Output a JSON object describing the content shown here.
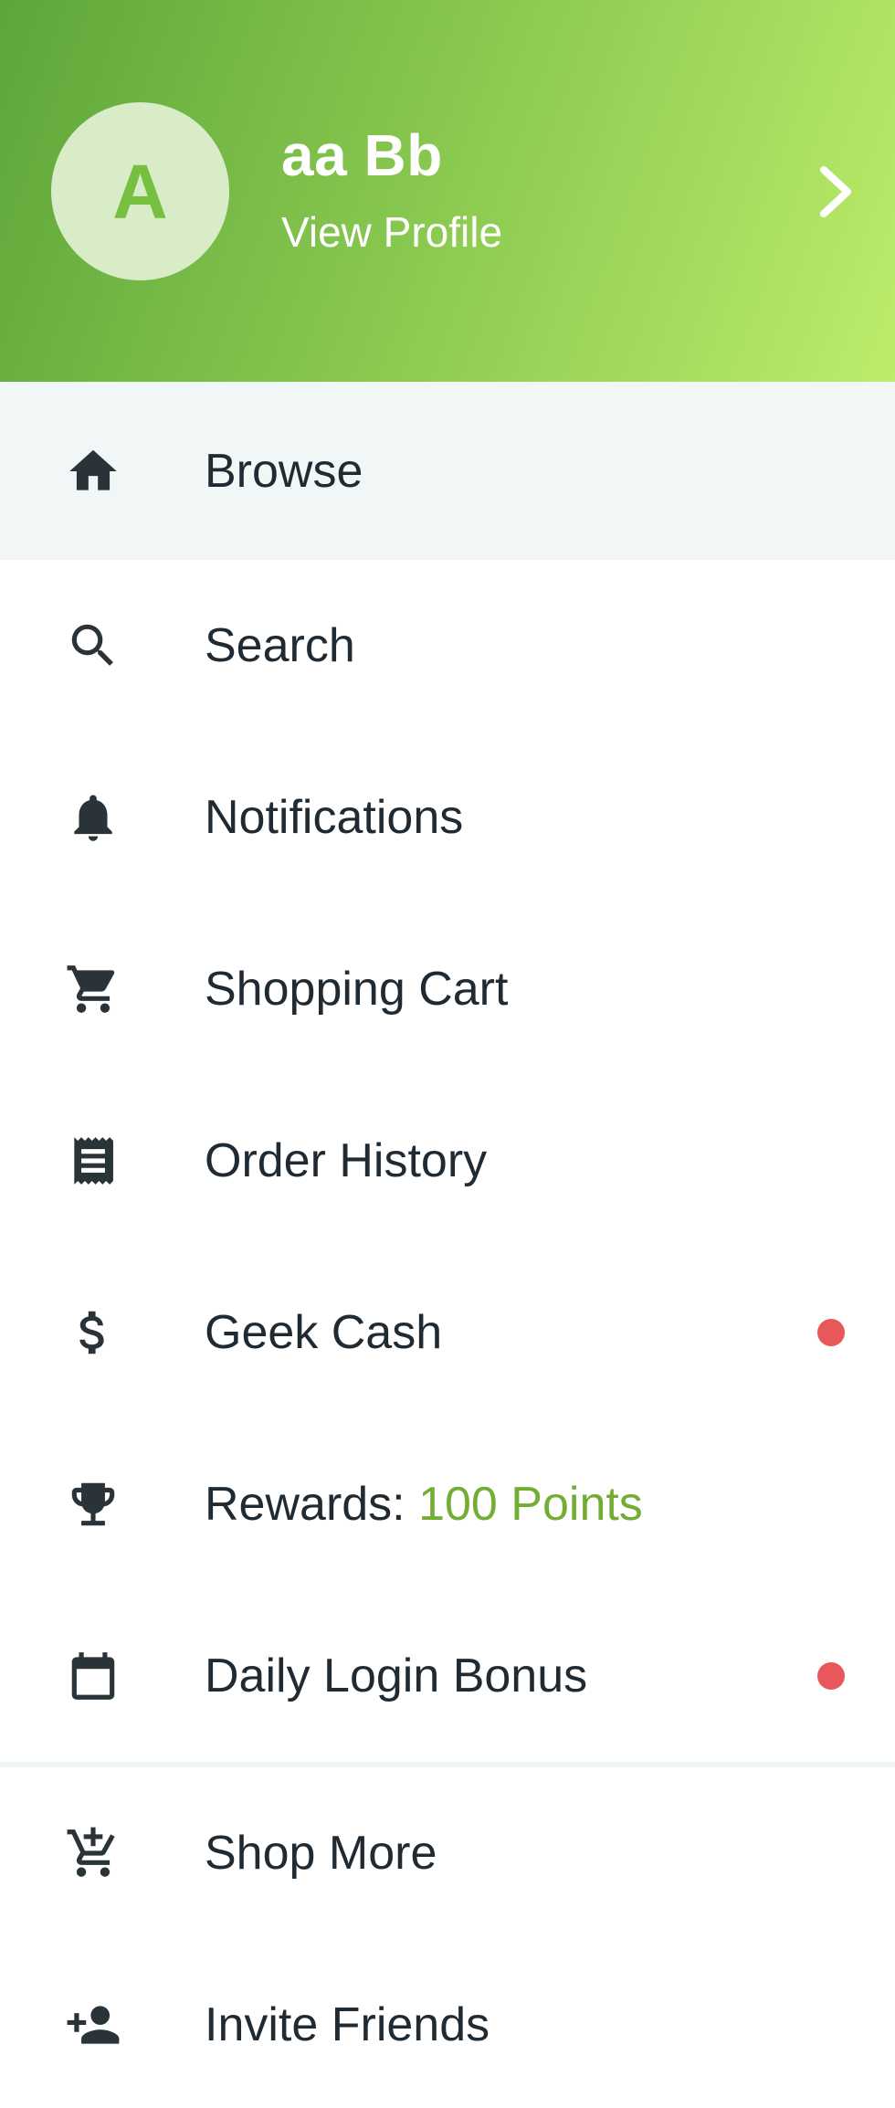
{
  "profile": {
    "initial": "A",
    "name": "aa Bb",
    "link_label": "View Profile"
  },
  "menu": {
    "browse": "Browse",
    "search": "Search",
    "notifications": "Notifications",
    "shopping_cart": "Shopping Cart",
    "order_history": "Order History",
    "geek_cash": "Geek Cash",
    "rewards_prefix": "Rewards: ",
    "rewards_points": "100 Points",
    "daily_login_bonus": "Daily Login Bonus",
    "shop_more": "Shop More",
    "invite_friends": "Invite Friends"
  },
  "icons": {
    "browse": "home-icon",
    "search": "search-icon",
    "notifications": "bell-icon",
    "shopping_cart": "cart-icon",
    "order_history": "receipt-icon",
    "geek_cash": "dollar-icon",
    "rewards": "trophy-icon",
    "daily_login_bonus": "calendar-icon",
    "shop_more": "cart-plus-icon",
    "invite_friends": "person-add-icon",
    "header_chevron": "chevron-right-icon"
  },
  "colors": {
    "header_gradient_start": "#5ea63a",
    "header_gradient_end": "#bdec6a",
    "avatar_bg": "#d9ecc8",
    "avatar_letter": "#76bf3f",
    "active_row_bg": "#f1f7f7",
    "accent_points": "#74ad34",
    "notification_dot": "#e8575a"
  }
}
